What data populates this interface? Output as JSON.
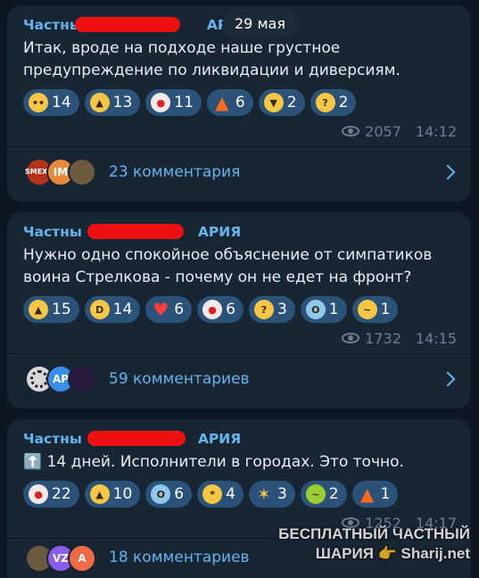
{
  "date_pill": "29 мая",
  "posts": [
    {
      "channel_left": "Частны",
      "channel_right": "АРИЯ",
      "text": "Итак, вроде на подходе наше грустное предупреждение по ликвидации и диверсиям.",
      "reactions": [
        {
          "icon": "crying-face-icon",
          "count": "14"
        },
        {
          "icon": "thumbs-up-icon",
          "count": "13"
        },
        {
          "icon": "clown-face-icon",
          "count": "11"
        },
        {
          "icon": "fire-icon",
          "count": "6"
        },
        {
          "icon": "thumbs-down-icon",
          "count": "2"
        },
        {
          "icon": "thinking-face-icon",
          "count": "2"
        }
      ],
      "views": "2057",
      "time": "14:12",
      "comments": "23 комментария",
      "avatar_labels": [
        "",
        "IM",
        ""
      ]
    },
    {
      "channel_left": "Частны",
      "channel_right": "АРИЯ",
      "text": "Нужно одно спокойное объяснение от симпатиков воина Стрелкова - почему он не едет на фронт?",
      "reactions": [
        {
          "icon": "thumbs-up-icon",
          "count": "15"
        },
        {
          "icon": "rofl-face-icon",
          "count": "14"
        },
        {
          "icon": "red-heart-icon",
          "count": "6"
        },
        {
          "icon": "clown-face-icon",
          "count": "6"
        },
        {
          "icon": "thinking-face-icon",
          "count": "3"
        },
        {
          "icon": "screaming-face-icon",
          "count": "1"
        },
        {
          "icon": "woozy-face-icon",
          "count": "1"
        }
      ],
      "views": "1732",
      "time": "14:15",
      "comments": "59 комментариев",
      "avatar_labels": [
        "",
        "AP",
        ""
      ]
    },
    {
      "channel_left": "Частны",
      "channel_right": "АРИЯ",
      "text": "⬆️ 14 дней. Исполнители в городах. Это точно.",
      "reactions": [
        {
          "icon": "clown-face-icon",
          "count": "22"
        },
        {
          "icon": "thumbs-up-icon",
          "count": "10"
        },
        {
          "icon": "screaming-face-icon",
          "count": "6"
        },
        {
          "icon": "exploding-head-icon",
          "count": "4"
        },
        {
          "icon": "party-popper-icon",
          "count": "3"
        },
        {
          "icon": "vomiting-face-icon",
          "count": "2"
        },
        {
          "icon": "fire-icon",
          "count": "1"
        }
      ],
      "views": "1252",
      "time": "14:17",
      "comments": "18 комментариев",
      "avatar_labels": [
        "",
        "VZ",
        "A"
      ]
    }
  ],
  "watermark": {
    "line1": "БЕСПЛАТНЫЙ ЧАСТНЫЙ",
    "line2": "ШАРИЯ 👉 Sharij.net"
  },
  "colors": {
    "bg": "#0e1621",
    "bubble": "#182533",
    "accent": "#64b5ef",
    "chip": "#2b5278",
    "redaction": "#ee1111"
  }
}
